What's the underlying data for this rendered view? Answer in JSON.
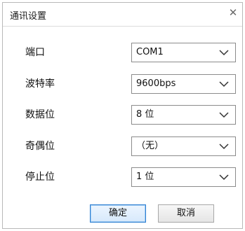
{
  "dialog": {
    "title": "通讯设置",
    "close_icon": "close-icon",
    "fields": [
      {
        "label": "端口",
        "value": "COM1"
      },
      {
        "label": "波特率",
        "value": "9600bps"
      },
      {
        "label": "数据位",
        "value": "8 位"
      },
      {
        "label": "奇偶位",
        "value": "（无）"
      },
      {
        "label": "停止位",
        "value": "1 位"
      }
    ],
    "buttons": {
      "ok_label": "确定",
      "cancel_label": "取消"
    }
  },
  "colors": {
    "ok_border": "#2d7fd2",
    "ok_fill": "#d7e9fb",
    "select_border": "#8b8b8b"
  }
}
